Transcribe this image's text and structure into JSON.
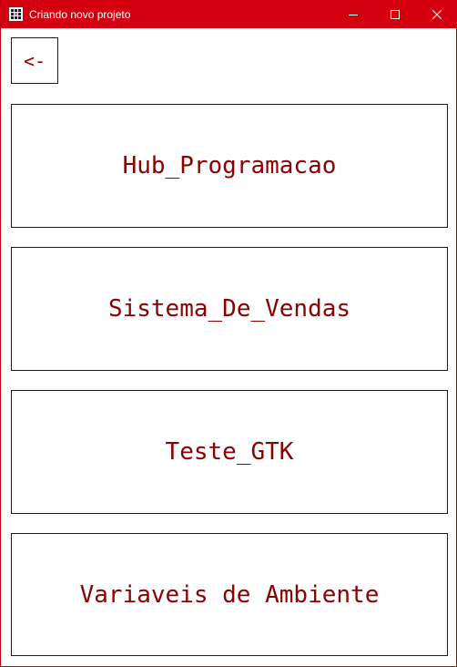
{
  "window": {
    "title": "Criando novo projeto",
    "accent_color": "#d4000f",
    "text_color": "#8b0000",
    "icon": "app-grid-icon",
    "controls": {
      "minimize_icon": "minimize-icon",
      "maximize_icon": "maximize-icon",
      "close_icon": "close-icon"
    }
  },
  "toolbar": {
    "back_label": "<-"
  },
  "projects": [
    {
      "label": "Hub_Programacao"
    },
    {
      "label": "Sistema_De_Vendas"
    },
    {
      "label": "Teste_GTK"
    },
    {
      "label": "Variaveis de Ambiente"
    }
  ]
}
